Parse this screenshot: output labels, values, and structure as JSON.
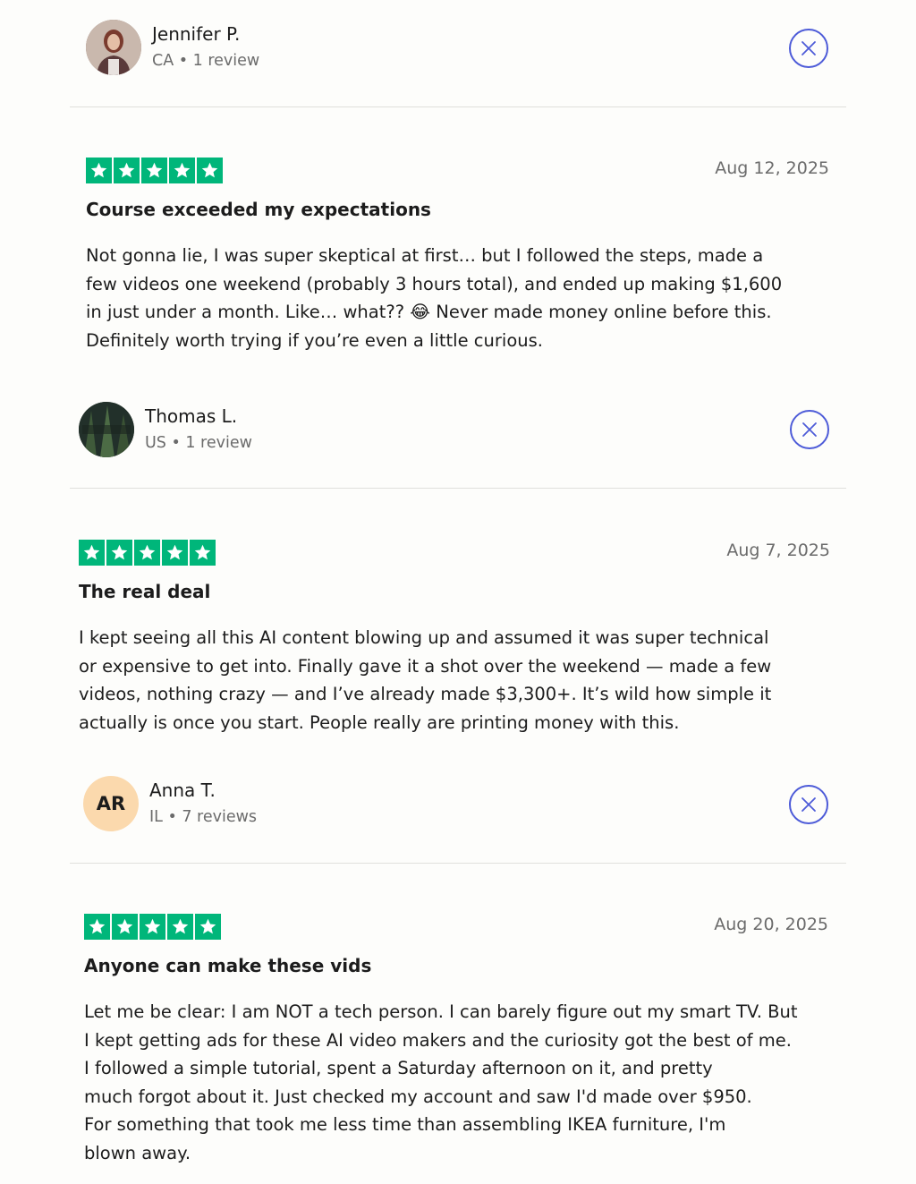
{
  "reviews": [
    {
      "reviewer_name": "Jennifer P.",
      "reviewer_meta": "CA • 1 review",
      "avatar": "photo-avatar",
      "rating": 5,
      "date": "Aug 12, 2025",
      "title": "Course exceeded my expectations",
      "body_lines": [
        "Not gonna lie, I was super skeptical at first… but I followed the steps, made a",
        "few videos one weekend (probably 3 hours total), and ended up making $1,600",
        "in just under a month. Like… what?? 😂 Never made money online before this.",
        "Definitely worth trying if you’re even a little curious."
      ]
    },
    {
      "reviewer_name": "Thomas L.",
      "reviewer_meta": "US • 1 review",
      "avatar": "photo-avatar",
      "rating": 5,
      "date": "Aug 7, 2025",
      "title": "The real deal",
      "body_lines": [
        "I kept seeing all this AI content blowing up and assumed it was super technical",
        "or expensive to get into. Finally gave it a shot over the weekend — made a few",
        "videos, nothing crazy — and I’ve already made $3,300+. It’s wild how simple it",
        "actually is once you start. People really are printing money with this."
      ]
    },
    {
      "reviewer_name": "Anna T.",
      "reviewer_meta": "IL • 7 reviews",
      "avatar_initials": "AR",
      "rating": 5,
      "date": "Aug 20, 2025",
      "title": "Anyone can make these vids",
      "body_lines": [
        "Let me be clear: I am NOT a tech person. I can barely figure out my smart TV. But",
        "I kept getting ads for these AI video makers and the curiosity got the best of me.",
        "I followed a simple tutorial, spent a Saturday afternoon on it, and pretty",
        "much forgot about it. Just checked my account and saw I'd made over $950.",
        "For something that took me less time than assembling IKEA furniture, I'm",
        "blown away."
      ]
    }
  ],
  "colors": {
    "star_green": "#00b67a",
    "close_blue": "#4d5bd8",
    "initials_bg": "#fbd9ad"
  },
  "icons": {
    "star": "star-icon",
    "close": "close-icon"
  }
}
